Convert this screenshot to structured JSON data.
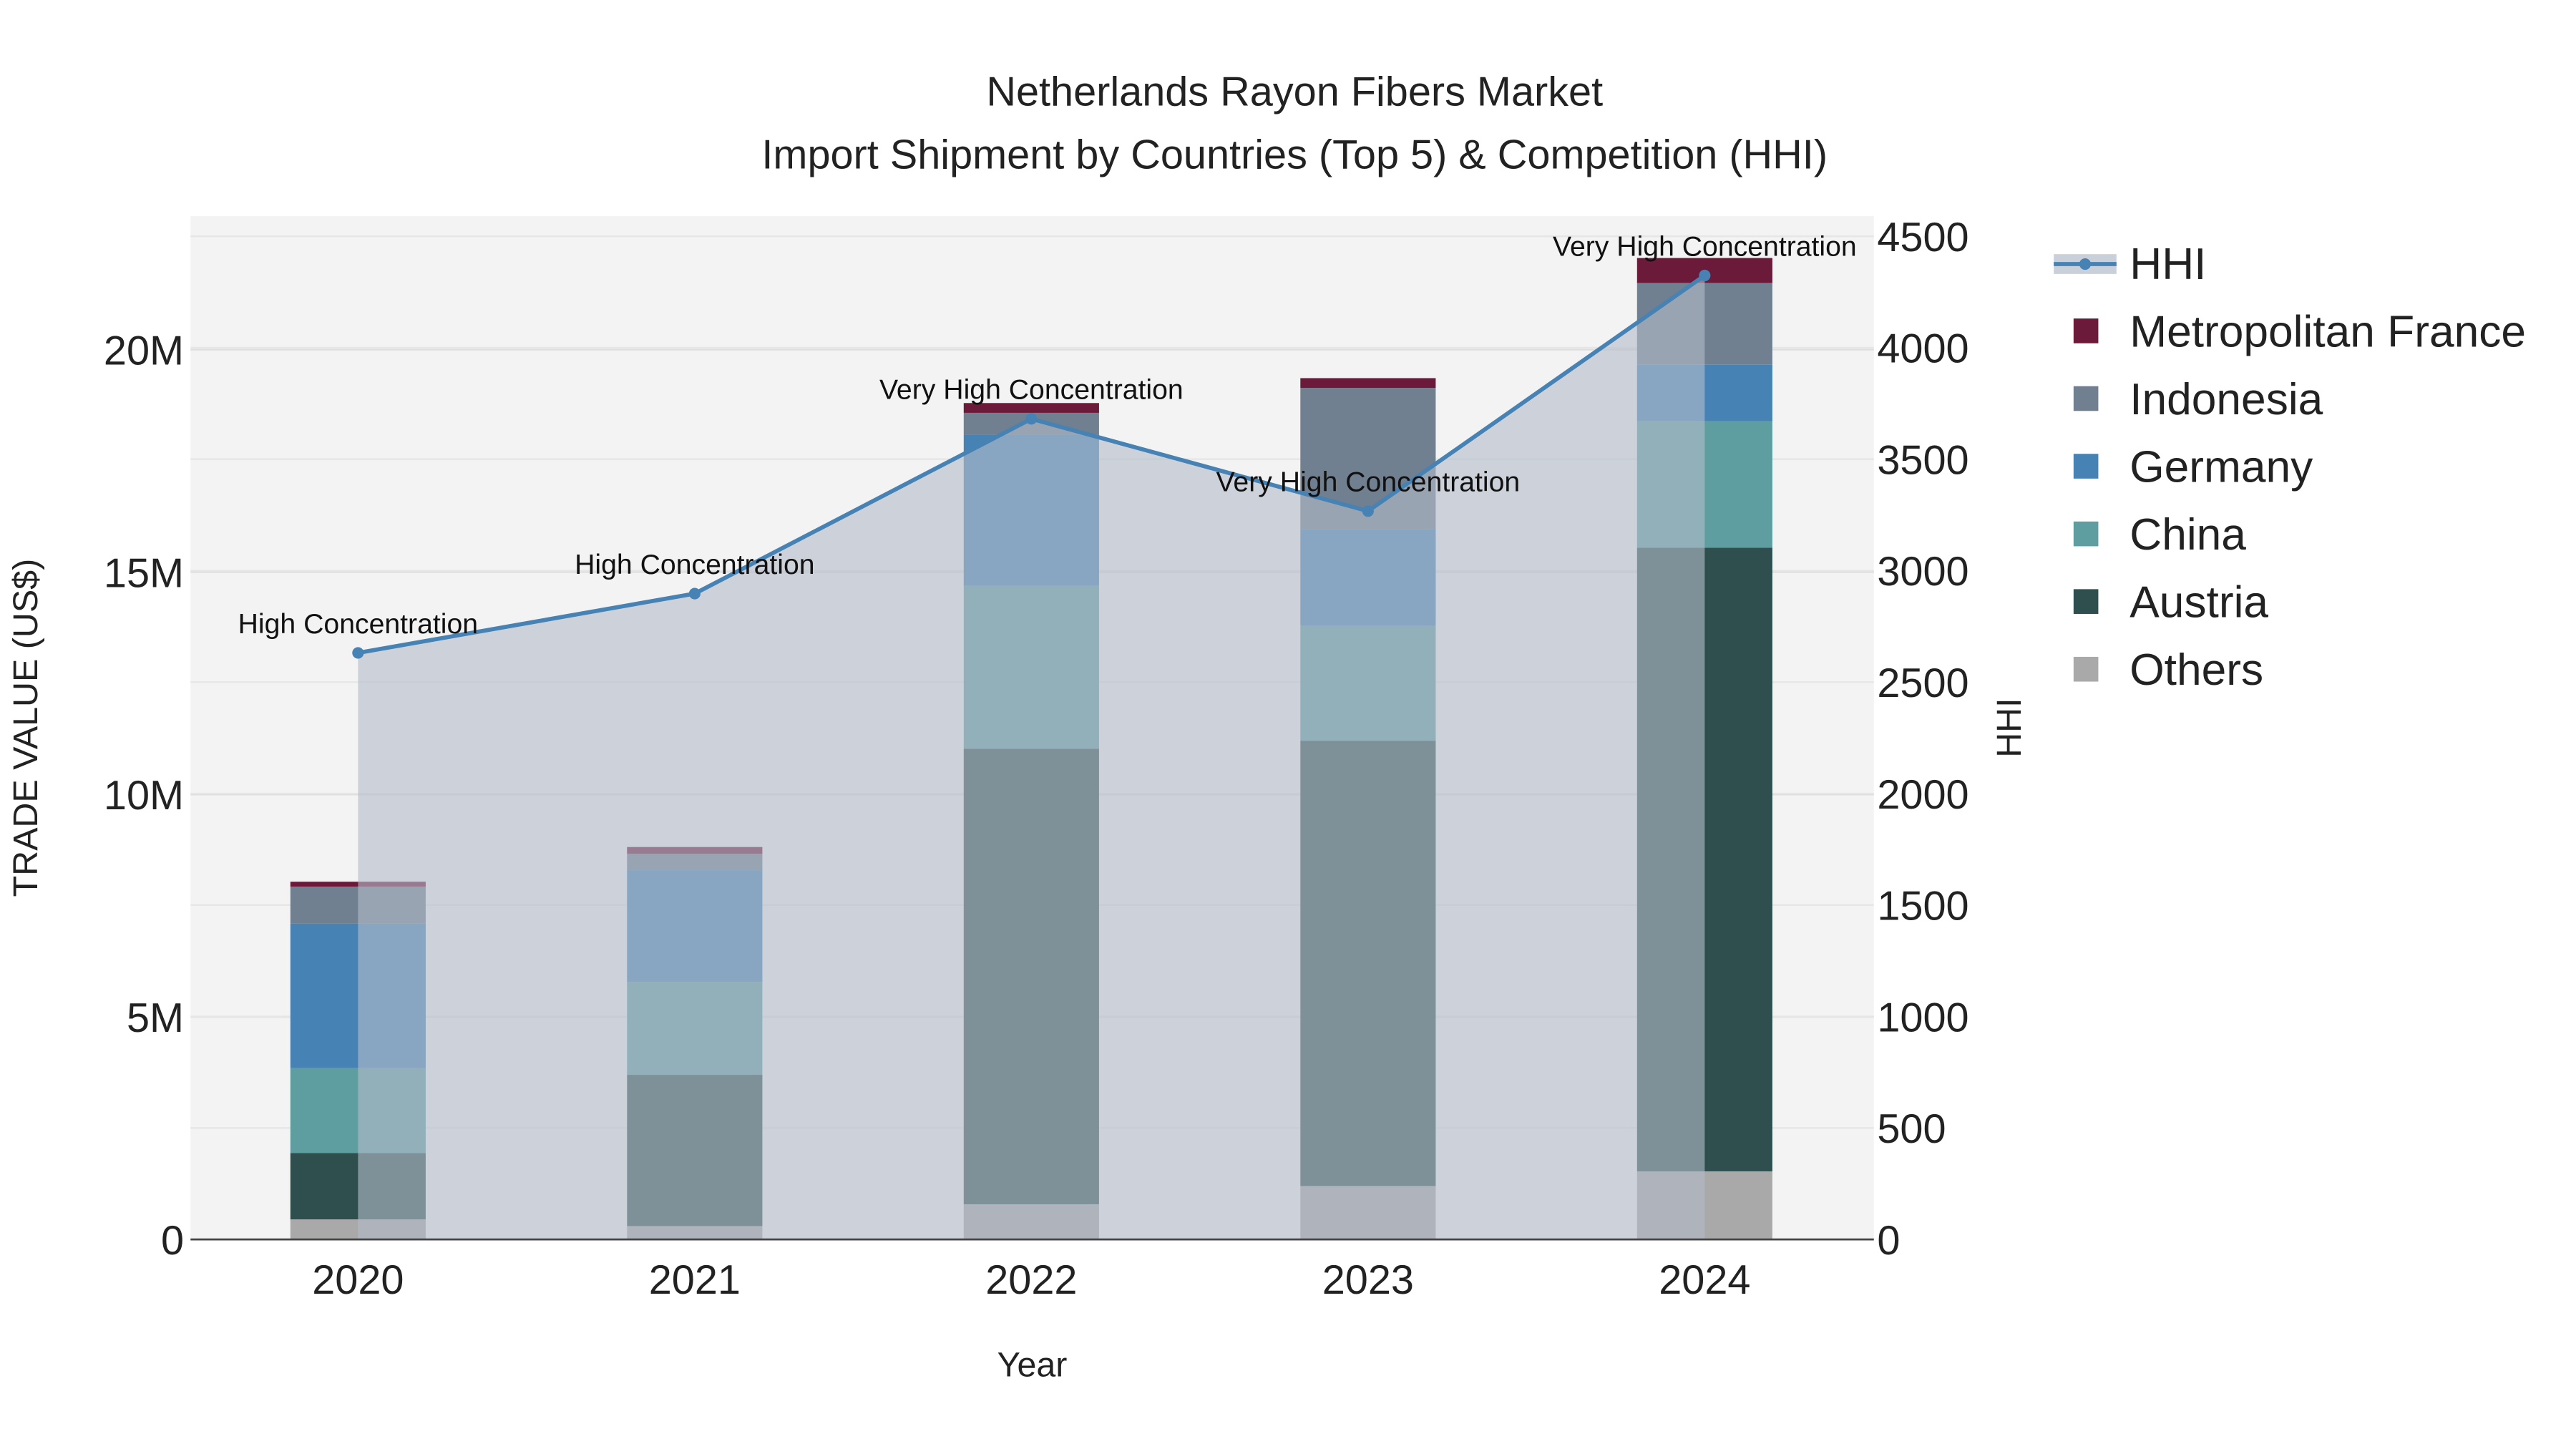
{
  "chart_data": {
    "type": "bar",
    "stacked": true,
    "title": "Netherlands Rayon Fibers Market",
    "subtitle": "Import Shipment by Countries (Top 5) & Competition (HHI)",
    "xlabel": "Year",
    "ylabel": "TRADE VALUE (US$)",
    "y2label": "HHI",
    "categories": [
      "2020",
      "2021",
      "2022",
      "2023",
      "2024"
    ],
    "ylim": [
      0,
      23000000
    ],
    "y2lim": [
      0,
      4590
    ],
    "yticks": [
      {
        "v": 0,
        "label": "0"
      },
      {
        "v": 5000000,
        "label": "5M"
      },
      {
        "v": 10000000,
        "label": "10M"
      },
      {
        "v": 15000000,
        "label": "15M"
      },
      {
        "v": 20000000,
        "label": "20M"
      }
    ],
    "y2ticks": [
      0,
      500,
      1000,
      1500,
      2000,
      2500,
      3000,
      3500,
      4000,
      4500
    ],
    "series": [
      {
        "name": "Others",
        "color": "#a9a9a9",
        "values": [
          450000,
          300000,
          790000,
          1200000,
          1530000
        ]
      },
      {
        "name": "Austria",
        "color": "#2f4f4f",
        "values": [
          1490000,
          3400000,
          10240000,
          10010000,
          14020000
        ]
      },
      {
        "name": "China",
        "color": "#5f9ea0",
        "values": [
          1910000,
          2090000,
          3660000,
          2580000,
          2840000
        ]
      },
      {
        "name": "Germany",
        "color": "#4682b4",
        "values": [
          3250000,
          2510000,
          3400000,
          2170000,
          1270000
        ]
      },
      {
        "name": "Indonesia",
        "color": "#708090",
        "values": [
          830000,
          370000,
          490000,
          3180000,
          1840000
        ]
      },
      {
        "name": "Metropolitan France",
        "color": "#6b1a3a",
        "values": [
          110000,
          150000,
          220000,
          220000,
          560000
        ]
      }
    ],
    "hhi": {
      "name": "HHI",
      "color": "#4682b4",
      "values": [
        2631,
        2897,
        3681,
        3267,
        4324
      ],
      "annotations": [
        "High Concentration",
        "High Concentration",
        "Very High Concentration",
        "Very High Concentration",
        "Very High Concentration"
      ]
    },
    "legend": [
      "HHI",
      "Metropolitan France",
      "Indonesia",
      "Germany",
      "China",
      "Austria",
      "Others"
    ],
    "legend_position": "right",
    "grid": true
  }
}
